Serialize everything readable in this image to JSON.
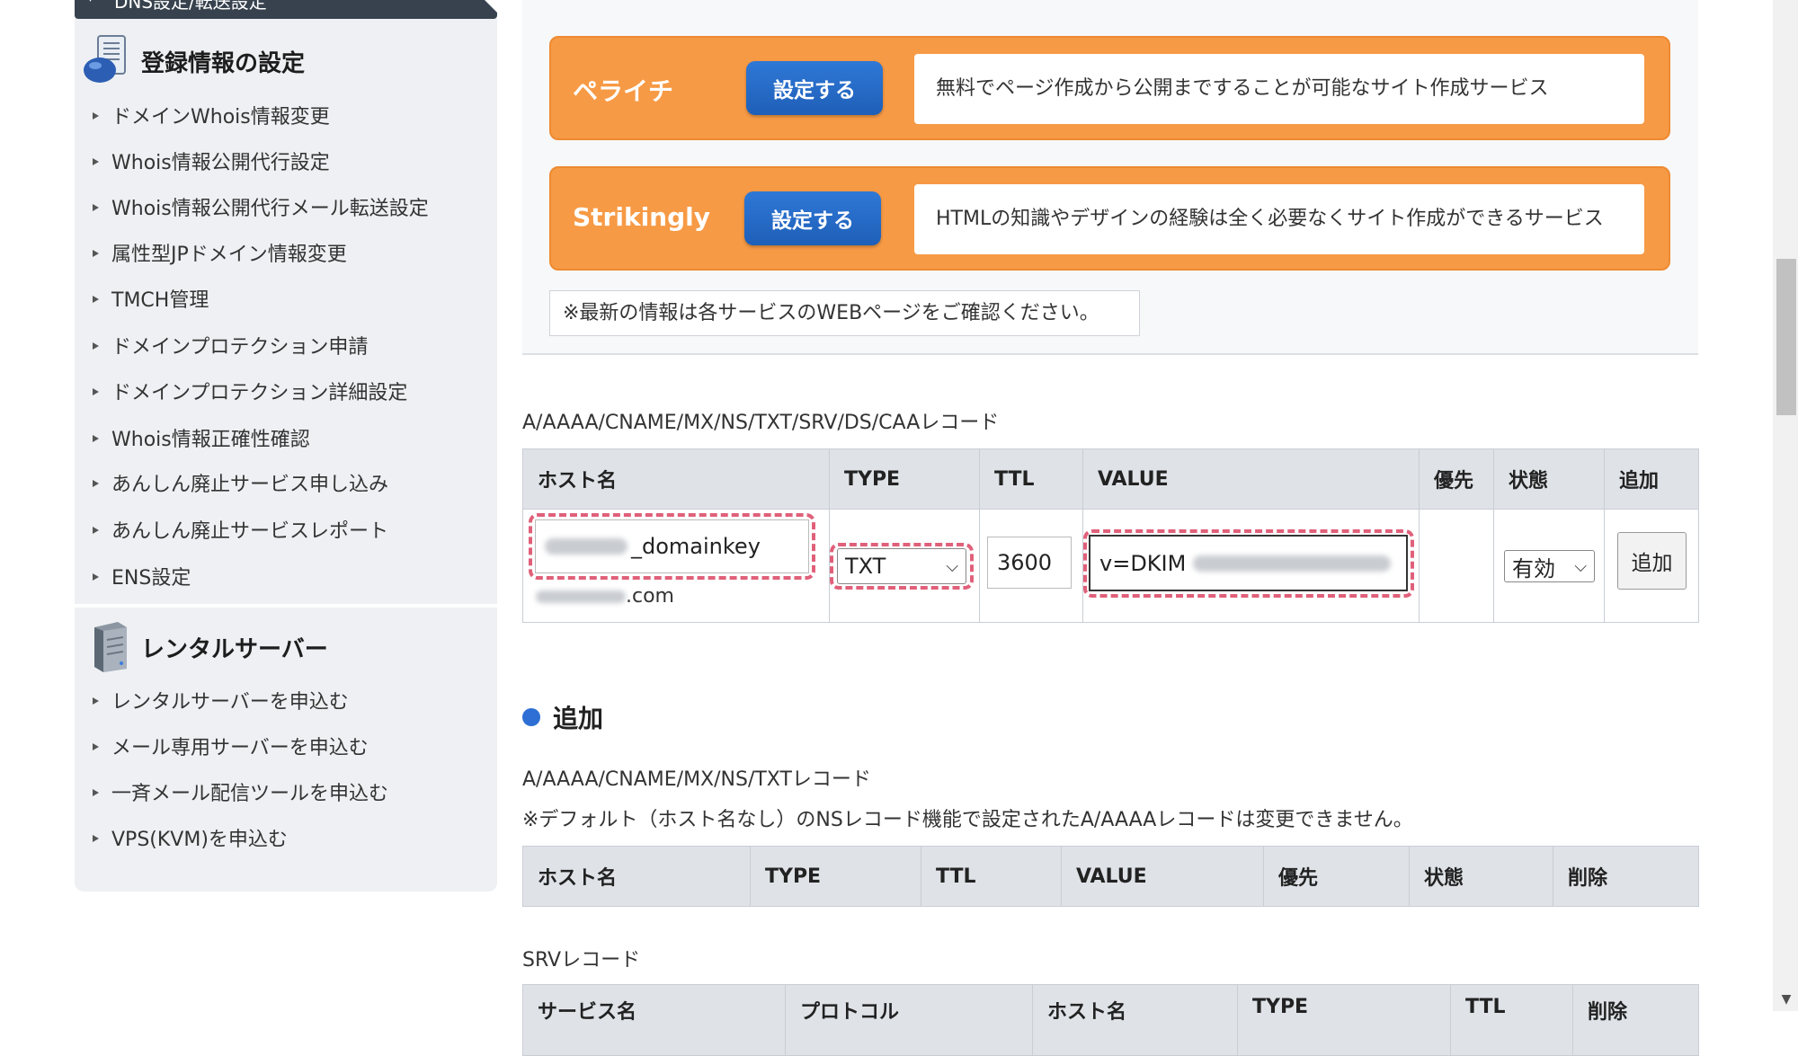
{
  "sidebar": {
    "top_item": "DNS設定/転送設定",
    "sections": [
      {
        "title": "登録情報の設定",
        "icon": "database-icon",
        "items": [
          "ドメインWhois情報変更",
          "Whois情報公開代行設定",
          "Whois情報公開代行メール転送設定",
          "属性型JPドメイン情報変更",
          "TMCH管理",
          "ドメインプロテクション申請",
          "ドメインプロテクション詳細設定",
          "Whois情報正確性確認",
          "あんしん廃止サービス申し込み",
          "あんしん廃止サービスレポート",
          "ENS設定"
        ]
      },
      {
        "title": "レンタルサーバー",
        "icon": "server-icon",
        "items": [
          "レンタルサーバーを申込む",
          "メール専用サーバーを申込む",
          "一斉メール配信ツールを申込む",
          "VPS(KVM)を申込む"
        ]
      }
    ]
  },
  "services": [
    {
      "name": "ペライチ",
      "button": "設定する",
      "description": "無料でページ作成から公開まですることが可能なサイト作成サービス"
    },
    {
      "name": "Strikingly",
      "button": "設定する",
      "description": "HTMLの知識やデザインの経験は全く必要なくサイト作成ができるサービス"
    }
  ],
  "notice": "※最新の情報は各サービスのWEBページをご確認ください。",
  "add_form": {
    "caption": "A/AAAA/CNAME/MX/NS/TXT/SRV/DS/CAAレコード",
    "columns": [
      "ホスト名",
      "TYPE",
      "TTL",
      "VALUE",
      "優先",
      "状態",
      "追加"
    ],
    "host_value": "_domainkey",
    "domain_suffix": ".com",
    "type_value": "TXT",
    "ttl_value": "3600",
    "value_value": "v=DKIM",
    "priority_value": "",
    "status_value": "有効",
    "add_button": "追加"
  },
  "section_heading": "追加",
  "records": {
    "caption": "A/AAAA/CNAME/MX/NS/TXTレコード",
    "note": "※デフォルト（ホスト名なし）のNSレコード機能で設定されたA/AAAAレコードは変更できません。",
    "columns": [
      "ホスト名",
      "TYPE",
      "TTL",
      "VALUE",
      "優先",
      "状態",
      "削除"
    ]
  },
  "srv": {
    "caption": "SRVレコード",
    "columns": [
      "サービス名",
      "プロトコル",
      "ホスト名",
      "TYPE",
      "TTL",
      "削除"
    ]
  },
  "colors": {
    "service_orange": "#f79a45",
    "button_blue": "#1e5fb8",
    "highlight_pink": "#e0607a",
    "sidebar_bg": "#eef0f3",
    "header_bg": "#dfe3e8",
    "heading_dot": "#2d6fd4"
  }
}
